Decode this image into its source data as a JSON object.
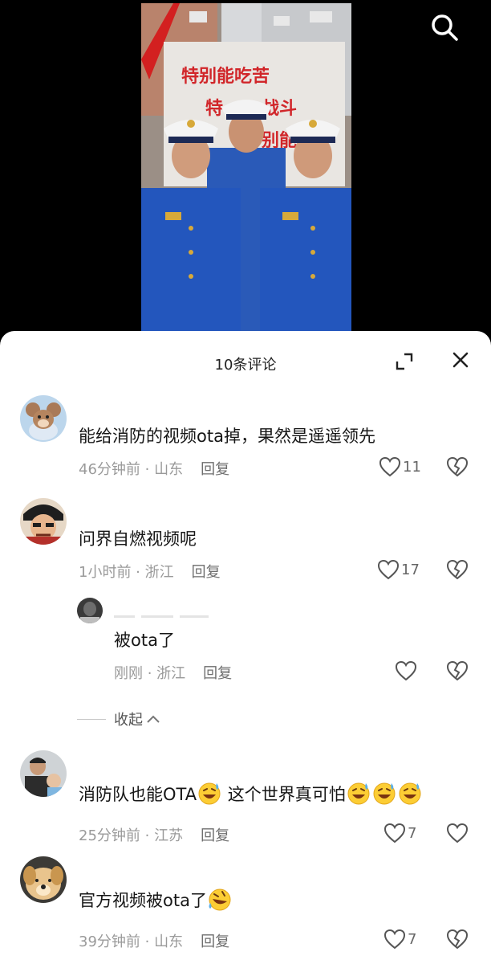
{
  "video": {
    "sign_lines": [
      "特别能吃苦",
      "特",
      "战斗",
      "别能"
    ]
  },
  "header": {
    "title": "10条评论"
  },
  "comments": [
    {
      "text": "能给消防的视频ota掉，果然是遥遥领先",
      "time": "46分钟前",
      "location": "山东",
      "reply": "回复",
      "likes": "11"
    },
    {
      "text": "问界自燃视频呢",
      "time": "1小时前",
      "location": "浙江",
      "reply": "回复",
      "likes": "17"
    },
    {
      "text_a": "消防队也能OTA",
      "text_b": " 这个世界真可怕",
      "time": "25分钟前",
      "location": "江苏",
      "reply": "回复",
      "likes": "7"
    },
    {
      "text": "官方视频被ota了",
      "time": "39分钟前",
      "location": "山东",
      "reply": "回复",
      "likes": "7"
    }
  ],
  "reply_comment": {
    "text": "被ota了",
    "time": "刚刚",
    "location": "浙江",
    "reply": "回复"
  },
  "meta_separator": " · ",
  "collapse_label": "收起",
  "icons": {
    "search": "search-icon",
    "expand": "expand-icon",
    "close": "close-icon",
    "like": "heart-icon",
    "dislike": "broken-heart-icon",
    "emoji": "sweat-smile-emoji"
  }
}
